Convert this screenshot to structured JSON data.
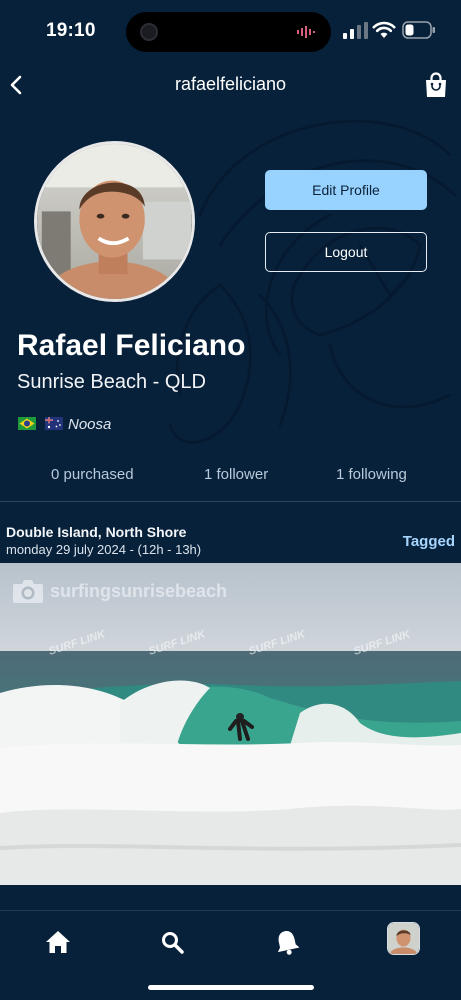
{
  "status_bar": {
    "time": "19:10",
    "icons": [
      "signal-icon",
      "wifi-icon",
      "battery-icon"
    ]
  },
  "header": {
    "title": "rafaelfeliciano",
    "icons": [
      "back-icon",
      "shopping-bag-icon"
    ]
  },
  "profile": {
    "name": "Rafael Feliciano",
    "location": "Sunrise Beach - QLD",
    "home_spot": "Noosa",
    "flags": [
      "brazil-flag-icon",
      "australia-flag-icon"
    ],
    "edit_label": "Edit Profile",
    "logout_label": "Logout"
  },
  "stats": {
    "purchased": "0 purchased",
    "followers": "1 follower",
    "following": "1 following"
  },
  "post": {
    "spot": "Double Island, North Shore",
    "date": "monday 29 july 2024 - (12h - 13h)",
    "tag": "Tagged",
    "photo_credit": "surfingsunrisebeach",
    "watermark_text": "SURF LINK"
  },
  "bottom_nav": {
    "items": [
      "home-icon",
      "search-icon",
      "bell-icon",
      "profile-avatar"
    ]
  },
  "colors": {
    "background": "#08213a",
    "accent": "#98d2ff",
    "tag": "#a6d5ff",
    "stats_text": "#b8c9da"
  }
}
